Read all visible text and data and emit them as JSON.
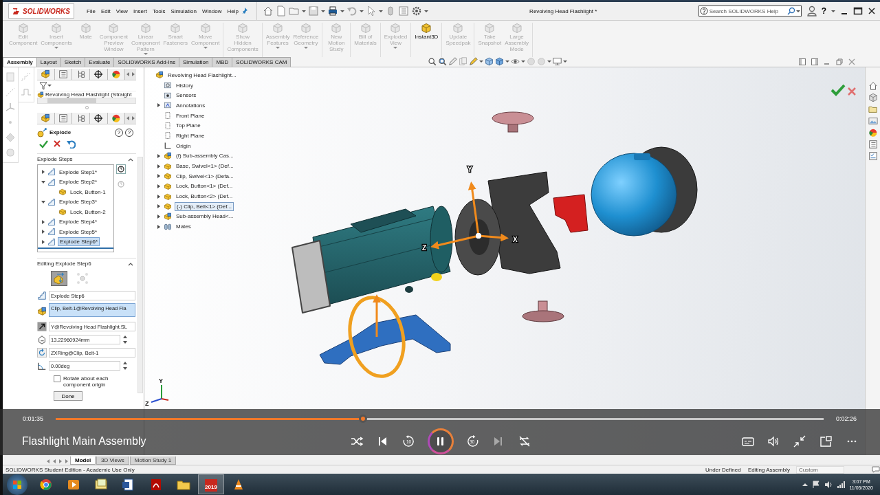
{
  "titlebar": {
    "logo": "SOLIDWORKS",
    "menu": [
      "File",
      "Edit",
      "View",
      "Insert",
      "Tools",
      "Simulation",
      "Window",
      "Help"
    ],
    "title": "Revolving Head Flashlight *",
    "search": {
      "placeholder": "Search SOLIDWORKS Help"
    },
    "help": "?"
  },
  "ribbon": {
    "groups": [
      {
        "buttons": [
          {
            "label": "Edit Component",
            "disabled": true,
            "menu": false
          },
          {
            "label": "Insert Components",
            "disabled": true,
            "menu": true
          },
          {
            "label": "Mate",
            "disabled": true,
            "menu": false
          },
          {
            "label": "Component Preview Window",
            "disabled": true,
            "menu": false
          },
          {
            "label": "Linear Component Pattern",
            "disabled": true,
            "menu": true
          },
          {
            "label": "Smart Fasteners",
            "disabled": true,
            "menu": false
          },
          {
            "label": "Move Component",
            "disabled": true,
            "menu": true
          }
        ]
      },
      {
        "buttons": [
          {
            "label": "Show Hidden Components",
            "disabled": true,
            "menu": false
          }
        ]
      },
      {
        "buttons": [
          {
            "label": "Assembly Features",
            "disabled": true,
            "menu": true
          },
          {
            "label": "Reference Geometry",
            "disabled": true,
            "menu": true
          }
        ]
      },
      {
        "buttons": [
          {
            "label": "New Motion Study",
            "disabled": true,
            "menu": false
          }
        ]
      },
      {
        "buttons": [
          {
            "label": "Bill of Materials",
            "disabled": true,
            "menu": false
          }
        ]
      },
      {
        "buttons": [
          {
            "label": "Exploded View",
            "disabled": true,
            "menu": true
          }
        ]
      },
      {
        "buttons": [
          {
            "label": "Instant3D",
            "disabled": false,
            "menu": false
          }
        ]
      },
      {
        "buttons": [
          {
            "label": "Update Speedpak",
            "disabled": true,
            "menu": false
          }
        ]
      },
      {
        "buttons": [
          {
            "label": "Take Snapshot",
            "disabled": true,
            "menu": false
          },
          {
            "label": "Large Assembly Mode",
            "disabled": true,
            "menu": false
          }
        ]
      }
    ]
  },
  "tabs": [
    {
      "label": "Assembly",
      "selected": true
    },
    {
      "label": "Layout",
      "selected": false
    },
    {
      "label": "Sketch",
      "selected": false
    },
    {
      "label": "Evaluate",
      "selected": false
    },
    {
      "label": "SOLIDWORKS Add-Ins",
      "selected": false
    },
    {
      "label": "Simulation",
      "selected": false
    },
    {
      "label": "MBD",
      "selected": false
    },
    {
      "label": "SOLIDWORKS CAM",
      "selected": false
    }
  ],
  "flyout_tree": {
    "root": "Revolving Head Flashlight (Straight"
  },
  "property_manager": {
    "title": "Explode",
    "help": [
      "?",
      "?"
    ],
    "explode_steps": {
      "heading": "Explode Steps",
      "expanded": true,
      "steps": [
        {
          "label": "Explode Step1*",
          "expanded": false,
          "selected": false
        },
        {
          "label": "Explode Step2*",
          "expanded": true,
          "selected": false,
          "children": [
            {
              "label": "Lock, Button-1"
            }
          ]
        },
        {
          "label": "Explode Step3*",
          "expanded": true,
          "selected": false,
          "children": [
            {
              "label": "Lock, Button-2"
            }
          ]
        },
        {
          "label": "Explode Step4*",
          "expanded": false,
          "selected": false
        },
        {
          "label": "Explode Step5*",
          "expanded": false,
          "selected": false
        },
        {
          "label": "Explode Step6*",
          "expanded": false,
          "selected": true
        }
      ]
    },
    "editing": {
      "heading": "Editing Explode Step6",
      "expanded": true,
      "modes": [
        {
          "selected": true
        },
        {
          "selected": false
        }
      ],
      "fields": [
        {
          "kind": "name",
          "value": "Explode Step6",
          "highlighted": false
        },
        {
          "kind": "components",
          "value": "Clip, Belt-1@Revolving Head Fla",
          "highlighted": true
        },
        {
          "kind": "direction",
          "value": "Y@Revolving Head Flashlight.SL",
          "highlighted": false
        },
        {
          "kind": "distance",
          "value": "13.22960924mm",
          "highlighted": false
        },
        {
          "kind": "axis",
          "value": "ZXRing@Clip, Belt-1",
          "highlighted": false
        },
        {
          "kind": "angle",
          "value": "0.00deg",
          "highlighted": false
        }
      ],
      "option": {
        "label": "Rotate about each component origin",
        "checked": false
      },
      "done": "Done"
    }
  },
  "feature_tree": {
    "root": {
      "label": "Revolving Head Flashlight...",
      "kind": "assembly"
    },
    "items": [
      {
        "label": "History",
        "kind": "history",
        "expandable": false,
        "selected": false
      },
      {
        "label": "Sensors",
        "kind": "sensors",
        "expandable": false,
        "selected": false
      },
      {
        "label": "Annotations",
        "kind": "annotations",
        "expandable": true,
        "selected": false
      },
      {
        "label": "Front Plane",
        "kind": "plane",
        "expandable": false,
        "selected": false
      },
      {
        "label": "Top Plane",
        "kind": "plane",
        "expandable": false,
        "selected": false
      },
      {
        "label": "Right Plane",
        "kind": "plane",
        "expandable": false,
        "selected": false
      },
      {
        "label": "Origin",
        "kind": "origin",
        "expandable": false,
        "selected": false
      },
      {
        "label": "(f) Sub-assembly Cas...",
        "kind": "subassembly",
        "expandable": true,
        "selected": false
      },
      {
        "label": "Base, Swivel<1> (Def...",
        "kind": "part",
        "expandable": true,
        "selected": false
      },
      {
        "label": "Clip, Swivel<1> (Defa...",
        "kind": "part",
        "expandable": true,
        "selected": false
      },
      {
        "label": "Lock, Button<1> (Def...",
        "kind": "part",
        "expandable": true,
        "selected": false
      },
      {
        "label": "Lock, Button<2> (Def...",
        "kind": "part",
        "expandable": true,
        "selected": false
      },
      {
        "label": "(-) Clip, Belt<1> (Def...",
        "kind": "part",
        "expandable": true,
        "selected": true
      },
      {
        "label": "Sub-assembly Head<...",
        "kind": "subassembly",
        "expandable": true,
        "selected": false
      },
      {
        "label": "Mates",
        "kind": "mates",
        "expandable": true,
        "selected": false
      }
    ]
  },
  "graphics": {
    "axes": [
      "Y",
      "Z",
      "X"
    ],
    "reference_axes": [
      "Y",
      "Z"
    ]
  },
  "model_tabs": [
    {
      "label": "Model",
      "selected": true
    },
    {
      "label": "3D Views",
      "selected": false
    },
    {
      "label": "Motion Study 1",
      "selected": false
    }
  ],
  "status_bar": {
    "edition": "SOLIDWORKS Student Edition - Academic Use Only",
    "state": "Under Defined",
    "mode": "Editing Assembly",
    "units": "Custom"
  },
  "player": {
    "title": "Flashlight Main Assembly",
    "elapsed": "0:01:35",
    "duration": "0:02:26",
    "level": 0.4,
    "controls": [
      {
        "kind": "shuffle",
        "disabled": false
      },
      {
        "kind": "previous",
        "disabled": false
      },
      {
        "kind": "rewind",
        "label": "10",
        "disabled": false
      },
      {
        "kind": "pause",
        "disabled": false
      },
      {
        "kind": "forward",
        "label": "30",
        "disabled": false
      },
      {
        "kind": "next",
        "disabled": true
      },
      {
        "kind": "repeat",
        "disabled": false
      }
    ],
    "tools": [
      {
        "kind": "captions"
      },
      {
        "kind": "volume"
      },
      {
        "kind": "shrink"
      },
      {
        "kind": "mini"
      },
      {
        "kind": "more"
      }
    ]
  },
  "taskbar": {
    "apps": [
      {
        "kind": "browser",
        "active": false
      },
      {
        "kind": "media",
        "active": false
      },
      {
        "kind": "notes",
        "active": false
      },
      {
        "kind": "word",
        "active": false
      },
      {
        "kind": "pdf",
        "active": false
      },
      {
        "kind": "folder",
        "active": false
      },
      {
        "kind": "cad",
        "label": "2019",
        "active": true
      },
      {
        "kind": "cone",
        "active": false
      }
    ],
    "time": "3:07 PM",
    "date": "11/05/2020"
  }
}
